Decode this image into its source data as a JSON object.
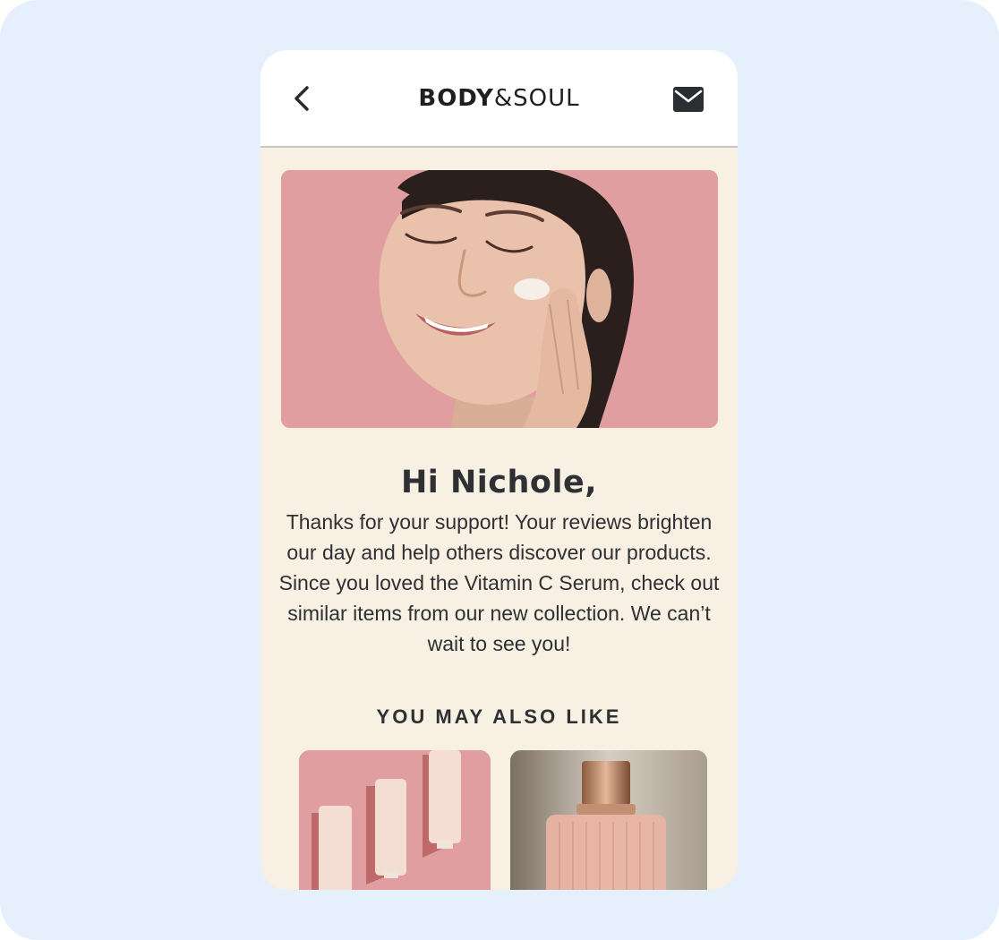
{
  "header": {
    "logo_bold": "BODY",
    "logo_light": "&SOUL",
    "back_icon": "chevron-left-icon",
    "mail_icon": "envelope-icon"
  },
  "hero": {
    "image": "woman-applying-face-cream",
    "background_color": "#e09ea0"
  },
  "content": {
    "greeting": "Hi Nichole,",
    "message": "Thanks for your support! Your reviews brighten our day and help others discover our products. Since you loved the Vitamin C Serum, check out similar items from our new collection. We can’t wait to see you!"
  },
  "recommendations": {
    "title": "YOU MAY ALSO LIKE",
    "items": [
      {
        "image": "cream-tubes",
        "background_color": "#e09ea0"
      },
      {
        "image": "perfume-bottle",
        "background_color": "#c9c0b3"
      }
    ]
  },
  "colors": {
    "canvas_bg": "#e6effc",
    "email_bg": "#f7f0e3",
    "text": "#2f3033",
    "accent_pink": "#e09ea0"
  }
}
